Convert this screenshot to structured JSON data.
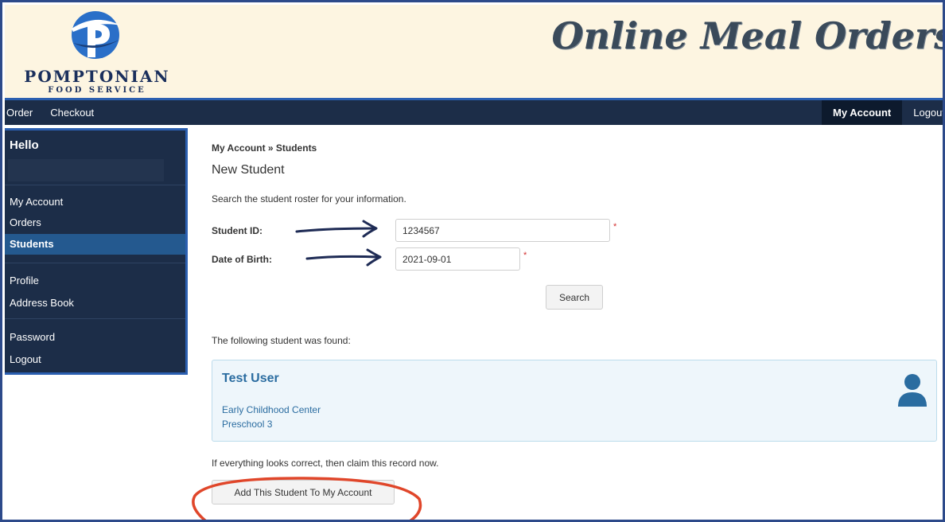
{
  "header": {
    "brand_name": "POMPTONIAN",
    "brand_sub": "FOOD SERVICE",
    "site_title": "Online Meal Orders"
  },
  "nav": {
    "left": [
      "Order",
      "Checkout"
    ],
    "my_account": "My Account",
    "logout": "Logout"
  },
  "sidebar": {
    "hello": "Hello",
    "items": [
      "My Account",
      "Orders",
      "Students",
      "Profile",
      "Address Book",
      "Password",
      "Logout"
    ],
    "active": "Students"
  },
  "main": {
    "breadcrumb": "My Account » Students",
    "title": "New Student",
    "instruction": "Search the student roster for your information.",
    "student_id_label": "Student ID:",
    "student_id_value": "1234567",
    "dob_label": "Date of Birth:",
    "dob_value": "2021-09-01",
    "required_mark": "*",
    "search_button": "Search",
    "found_text": "The following student was found:",
    "student": {
      "name": "Test User",
      "school": "Early Childhood Center",
      "grade": "Preschool 3"
    },
    "claim_text": "If everything looks correct, then claim this record now.",
    "add_button": "Add This Student To My Account"
  },
  "icons": {
    "logo": "pomptonian-p-logo",
    "user": "user-icon",
    "arrow": "arrow-right-icon",
    "highlight": "highlight-circle"
  },
  "colors": {
    "header_bg": "#fdf5e1",
    "nav_bg": "#1c2d48",
    "accent": "#2b5fb0",
    "active_item": "#24598f",
    "card_text": "#2a6ca0",
    "annotation_red": "#e0462a",
    "annotation_arrow": "#1e2b55"
  }
}
